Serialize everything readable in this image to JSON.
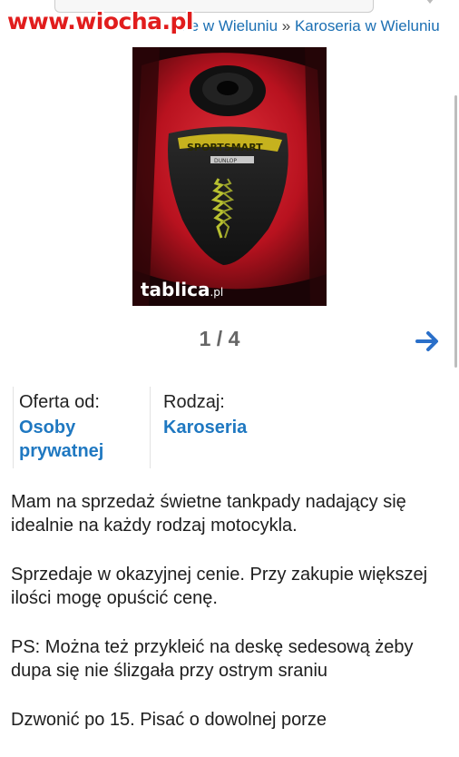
{
  "watermark": "www.wiocha.pl",
  "breadcrumb": {
    "prefix": "»",
    "item_partial": "ne w Wieluniu",
    "separator": "»",
    "current": "Karoseria w Wieluniu"
  },
  "gallery": {
    "image_logo": "tablica",
    "image_logo_suffix": ".pl",
    "counter": "1 / 4",
    "next_icon": "arrow-right-icon"
  },
  "info": {
    "offer_label": "Oferta od:",
    "offer_value": "Osoby prywatnej",
    "type_label": "Rodzaj:",
    "type_value": "Karoseria"
  },
  "description": [
    "Mam na sprzedaż świetne tankpady nadający się idealnie na każdy rodzaj motocykla.",
    "Sprzedaje w okazyjnej cenie. Przy zakupie większej ilości mogę opuścić cenę.",
    "PS: Można też przykleić na deskę sedesową żeby dupa się nie ślizgała przy ostrym sraniu",
    "Dzwonić po 15. Pisać o dowolnej porze"
  ],
  "colors": {
    "link": "#1f78c1",
    "watermark": "#e11d1d",
    "arrow": "#2a6fc9"
  }
}
